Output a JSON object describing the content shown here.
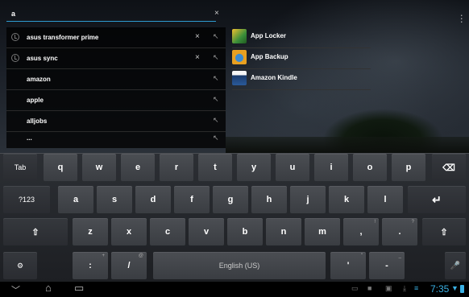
{
  "search": {
    "query": "a",
    "clear_icon": "×"
  },
  "suggestions": [
    {
      "text": "asus transformer prime",
      "history": true,
      "clear": "×",
      "arrow": "↖"
    },
    {
      "text": "asus sync",
      "history": true,
      "clear": "×",
      "arrow": "↖"
    },
    {
      "text": "amazon",
      "history": false,
      "arrow": "↖"
    },
    {
      "text": "apple",
      "history": false,
      "arrow": "↖"
    },
    {
      "text": "alljobs",
      "history": false,
      "arrow": "↖"
    },
    {
      "text": "...",
      "history": false,
      "arrow": "↖"
    }
  ],
  "apps": [
    {
      "label": "App Locker",
      "icon": "app-locker-icon",
      "color": "#3a8f3a"
    },
    {
      "label": "App Backup",
      "icon": "app-backup-icon",
      "color": "#e8a020"
    },
    {
      "label": "Amazon Kindle",
      "icon": "kindle-icon",
      "color": "#1a3a6a"
    }
  ],
  "keyboard": {
    "row1": [
      "Tab",
      "q",
      "w",
      "e",
      "r",
      "t",
      "y",
      "u",
      "i",
      "o",
      "p",
      "⌫"
    ],
    "row2": [
      "?123",
      "a",
      "s",
      "d",
      "f",
      "g",
      "h",
      "j",
      "k",
      "l",
      "↵"
    ],
    "row3": [
      "⇧",
      "z",
      "x",
      "c",
      "v",
      "b",
      "n",
      "m",
      ",",
      ".",
      "⇧"
    ],
    "row3_hints": {
      "comma": "!",
      "period": "?"
    },
    "row4": {
      "settings": "⚙",
      "colon": ":",
      "colon_hint": "+",
      "slash": "/",
      "slash_hint": "@",
      "space": "English (US)",
      "apostrophe": "'",
      "apostrophe_hint": "\"",
      "dash": "-",
      "dash_hint": "_",
      "mic": "🎤"
    }
  },
  "navbar": {
    "back": "﹀",
    "home": "⌂",
    "recent": "▭",
    "clock": "7:35"
  },
  "colors": {
    "accent": "#3ab0e4",
    "key": "#44474c",
    "background": "#1d1f23"
  }
}
